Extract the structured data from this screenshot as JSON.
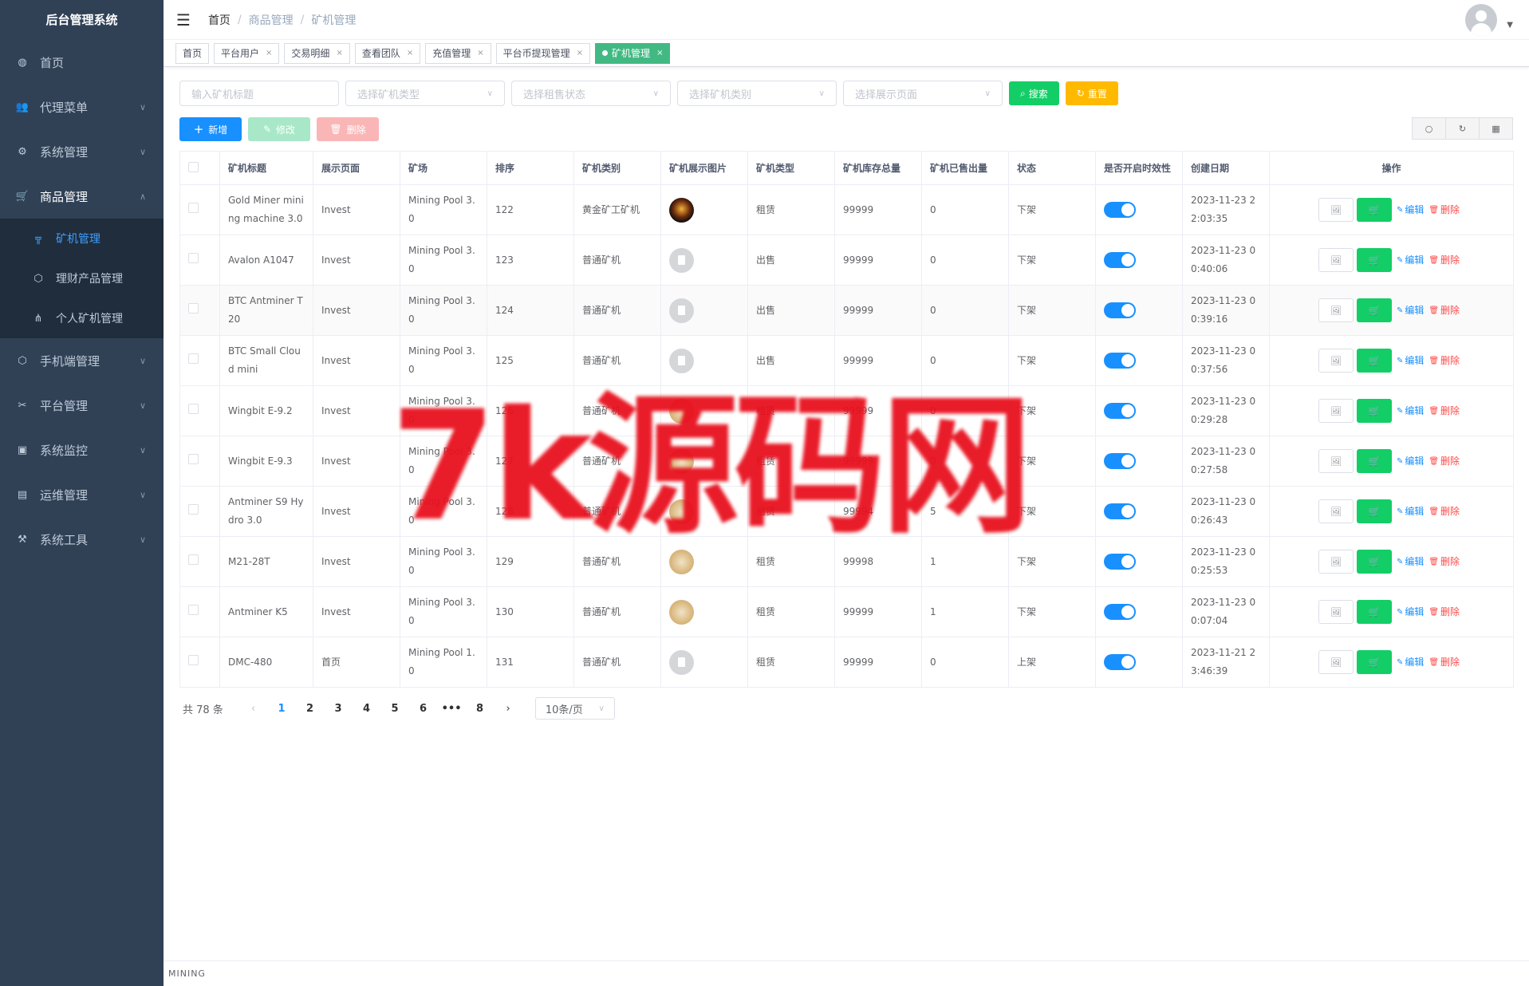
{
  "app": {
    "title": "后台管理系统"
  },
  "sidebar": {
    "items": [
      {
        "label": "首页",
        "icon": "dashboard-icon"
      },
      {
        "label": "代理菜单",
        "icon": "agent-icon"
      },
      {
        "label": "系统管理",
        "icon": "gear-icon"
      },
      {
        "label": "商品管理",
        "icon": "cart-icon"
      },
      {
        "label": "手机端管理",
        "icon": "phone-icon"
      },
      {
        "label": "平台管理",
        "icon": "tool-icon"
      },
      {
        "label": "系统监控",
        "icon": "monitor-icon"
      },
      {
        "label": "运维管理",
        "icon": "server-icon"
      },
      {
        "label": "系统工具",
        "icon": "wrench-icon"
      }
    ],
    "subitems": [
      {
        "label": "矿机管理",
        "icon": "miner-icon"
      },
      {
        "label": "理财产品管理",
        "icon": "cube-icon"
      },
      {
        "label": "个人矿机管理",
        "icon": "tree-icon"
      }
    ]
  },
  "breadcrumb": {
    "home": "首页",
    "level1": "商品管理",
    "current": "矿机管理"
  },
  "tags": [
    "首页",
    "平台用户",
    "交易明细",
    "查看团队",
    "充值管理",
    "平台币提现管理",
    "矿机管理"
  ],
  "filters": {
    "title_placeholder": "输入矿机标题",
    "type_placeholder": "选择矿机类型",
    "rent_placeholder": "选择租售状态",
    "category_placeholder": "选择矿机类别",
    "page_placeholder": "选择展示页面",
    "search_label": "搜索",
    "reset_label": "重置"
  },
  "toolbar": {
    "add_label": "新增",
    "edit_label": "修改",
    "delete_label": "删除"
  },
  "table": {
    "columns": [
      "矿机标题",
      "展示页面",
      "矿场",
      "排序",
      "矿机类别",
      "矿机展示图片",
      "矿机类型",
      "矿机库存总量",
      "矿机已售出量",
      "状态",
      "是否开启时效性",
      "创建日期",
      "操作"
    ],
    "rows": [
      {
        "title": "Gold Miner mining machine 3.0",
        "page": "Invest",
        "pool": "Mining Pool 3.0",
        "sort": "122",
        "category": "黄金矿工矿机",
        "img": "gold",
        "type": "租赁",
        "stock": "99999",
        "sold": "0",
        "status": "下架",
        "date": "2023-11-23 22:03:35"
      },
      {
        "title": "Avalon A1047",
        "page": "Invest",
        "pool": "Mining Pool 3.0",
        "sort": "123",
        "category": "普通矿机",
        "img": "gray",
        "type": "出售",
        "stock": "99999",
        "sold": "0",
        "status": "下架",
        "date": "2023-11-23 00:40:06"
      },
      {
        "title": "BTC Antminer T20",
        "page": "Invest",
        "pool": "Mining Pool 3.0",
        "sort": "124",
        "category": "普通矿机",
        "img": "gray",
        "type": "出售",
        "stock": "99999",
        "sold": "0",
        "status": "下架",
        "date": "2023-11-23 00:39:16"
      },
      {
        "title": "BTC Small Cloud mini",
        "page": "Invest",
        "pool": "Mining Pool 3.0",
        "sort": "125",
        "category": "普通矿机",
        "img": "gray",
        "type": "出售",
        "stock": "99999",
        "sold": "0",
        "status": "下架",
        "date": "2023-11-23 00:37:56"
      },
      {
        "title": "Wingbit E-9.2",
        "page": "Invest",
        "pool": "Mining Pool 3.0",
        "sort": "126",
        "category": "普通矿机",
        "img": "coin",
        "type": "租赁",
        "stock": "99999",
        "sold": "0",
        "status": "下架",
        "date": "2023-11-23 00:29:28"
      },
      {
        "title": "Wingbit E-9.3",
        "page": "Invest",
        "pool": "Mining Pool 3.0",
        "sort": "127",
        "category": "普通矿机",
        "img": "coin",
        "type": "租赁",
        "stock": "99999",
        "sold": "0",
        "status": "下架",
        "date": "2023-11-23 00:27:58"
      },
      {
        "title": "Antminer S9 Hydro 3.0",
        "page": "Invest",
        "pool": "Mining Pool 3.0",
        "sort": "128",
        "category": "普通矿机",
        "img": "coin",
        "type": "租赁",
        "stock": "99994",
        "sold": "5",
        "status": "下架",
        "date": "2023-11-23 00:26:43"
      },
      {
        "title": "M21-28T",
        "page": "Invest",
        "pool": "Mining Pool 3.0",
        "sort": "129",
        "category": "普通矿机",
        "img": "coin",
        "type": "租赁",
        "stock": "99998",
        "sold": "1",
        "status": "下架",
        "date": "2023-11-23 00:25:53"
      },
      {
        "title": "Antminer K5",
        "page": "Invest",
        "pool": "Mining Pool 3.0",
        "sort": "130",
        "category": "普通矿机",
        "img": "coin",
        "type": "租赁",
        "stock": "99999",
        "sold": "1",
        "status": "下架",
        "date": "2023-11-23 00:07:04"
      },
      {
        "title": "DMC-480",
        "page": "首页",
        "pool": "Mining Pool 1.0",
        "sort": "131",
        "category": "普通矿机",
        "img": "gray",
        "type": "租赁",
        "stock": "99999",
        "sold": "0",
        "status": "上架",
        "date": "2023-11-21 23:46:39"
      }
    ],
    "edit_label": "编辑",
    "delete_label": "删除"
  },
  "pagination": {
    "total": "共 78 条",
    "pages": [
      "1",
      "2",
      "3",
      "4",
      "5",
      "6",
      "•••",
      "8"
    ],
    "current": "1",
    "size": "10条/页"
  },
  "footer": {
    "text": "MINING"
  },
  "watermark": {
    "text": "7k源码网"
  },
  "colors": {
    "sidebar": "#304156",
    "primary": "#1890ff",
    "success": "#13ce66",
    "warning": "#ffba00",
    "danger": "#ff4949",
    "tag_active": "#42b983"
  }
}
